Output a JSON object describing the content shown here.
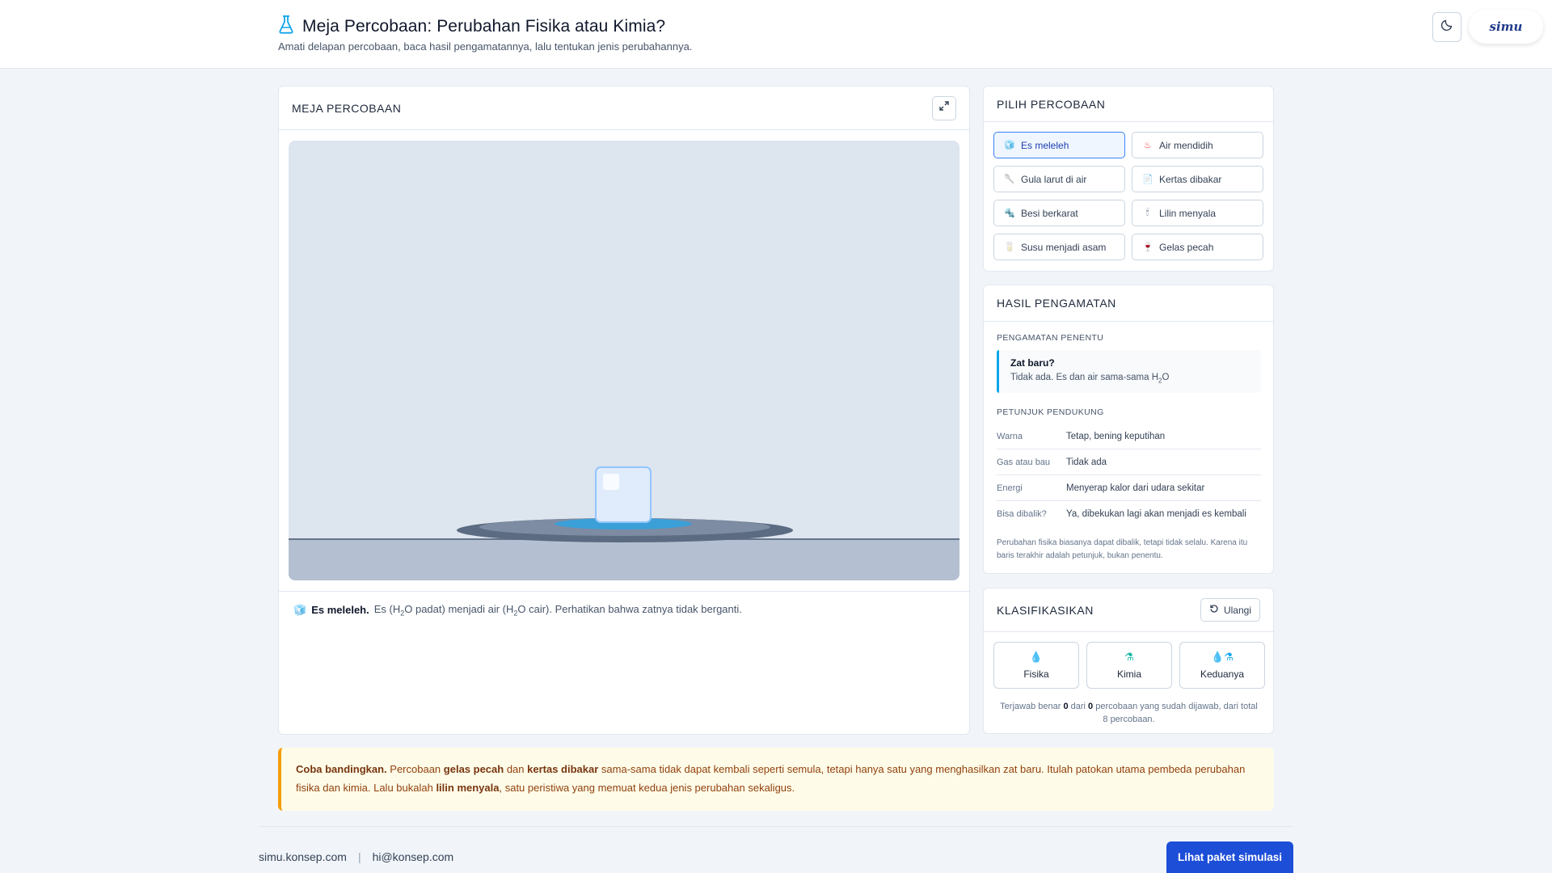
{
  "header": {
    "title": "Meja Percobaan: Perubahan Fisika atau Kimia?",
    "subtitle": "Amati delapan percobaan, baca hasil pengamatannya, lalu tentukan jenis perubahannya.",
    "logo": "simu",
    "icons": {
      "title": "flask-icon",
      "theme": "moon-icon"
    }
  },
  "lab": {
    "title": "MEJA PERCOBAAN",
    "caption_title": "Es meleleh.",
    "caption_icon": "🧊",
    "caption_parts": [
      "Es (H",
      "2",
      "O padat) menjadi air (H",
      "2",
      "O cair). Perhatikan bahwa zatnya tidak berganti."
    ]
  },
  "select": {
    "title": "PILIH PERCOBAAN",
    "active_index": 0,
    "items": [
      {
        "icon": "🧊",
        "label": "Es meleleh"
      },
      {
        "icon": "♨",
        "label": "Air mendidih"
      },
      {
        "icon": "🥄",
        "label": "Gula larut di air"
      },
      {
        "icon": "📄",
        "label": "Kertas dibakar"
      },
      {
        "icon": "🔩",
        "label": "Besi berkarat"
      },
      {
        "icon": "🕯",
        "label": "Lilin menyala"
      },
      {
        "icon": "🥛",
        "label": "Susu menjadi asam"
      },
      {
        "icon": "🍷",
        "label": "Gelas pecah"
      }
    ]
  },
  "observation": {
    "title": "HASIL PENGAMATAN",
    "key_label": "PENGAMATAN PENENTU",
    "key_question": "Zat baru?",
    "key_answer_parts": [
      "Tidak ada. Es dan air sama-sama H",
      "2",
      "O"
    ],
    "hints_label": "PETUNJUK PENDUKUNG",
    "hints": [
      {
        "key": "Warna",
        "value": "Tetap, bening keputihan"
      },
      {
        "key": "Gas atau bau",
        "value": "Tidak ada"
      },
      {
        "key": "Energi",
        "value": "Menyerap kalor dari udara sekitar"
      },
      {
        "key": "Bisa dibalik?",
        "value": "Ya, dibekukan lagi akan menjadi es kembali"
      }
    ],
    "note": "Perubahan fisika biasanya dapat dibalik, tetapi tidak selalu. Karena itu baris terakhir adalah petunjuk, bukan penentu."
  },
  "classify": {
    "title": "KLASIFIKASIKAN",
    "reset_label": "Ulangi",
    "options": [
      {
        "icons": "💧",
        "label": "Fisika"
      },
      {
        "icons": "⚗",
        "label": "Kimia"
      },
      {
        "icons": "💧⚗",
        "label": "Keduanya"
      }
    ],
    "score_parts": [
      "Terjawab benar ",
      "0",
      " dari ",
      "0",
      " percobaan yang sudah dijawab, dari total 8 percobaan."
    ]
  },
  "tip": {
    "parts": [
      {
        "t": "Coba bandingkan.",
        "b": true
      },
      {
        "t": " Percobaan ",
        "b": false
      },
      {
        "t": "gelas pecah",
        "b": true
      },
      {
        "t": " dan ",
        "b": false
      },
      {
        "t": "kertas dibakar",
        "b": true
      },
      {
        "t": " sama-sama tidak dapat kembali seperti semula, tetapi hanya satu yang menghasilkan zat baru. Itulah patokan utama pembeda perubahan fisika dan kimia. Lalu bukalah ",
        "b": false
      },
      {
        "t": "lilin menyala",
        "b": true
      },
      {
        "t": ", satu peristiwa yang memuat kedua jenis perubahan sekaligus.",
        "b": false
      }
    ]
  },
  "footer": {
    "site": "simu.konsep.com",
    "separator": "|",
    "email": "hi@konsep.com",
    "cta": "Lihat paket simulasi"
  },
  "colors": {
    "accent": "#1d4ed8",
    "info_bar": "#0ea5e9",
    "tip_bar": "#f59e0b",
    "tip_bg": "#fefce8"
  }
}
